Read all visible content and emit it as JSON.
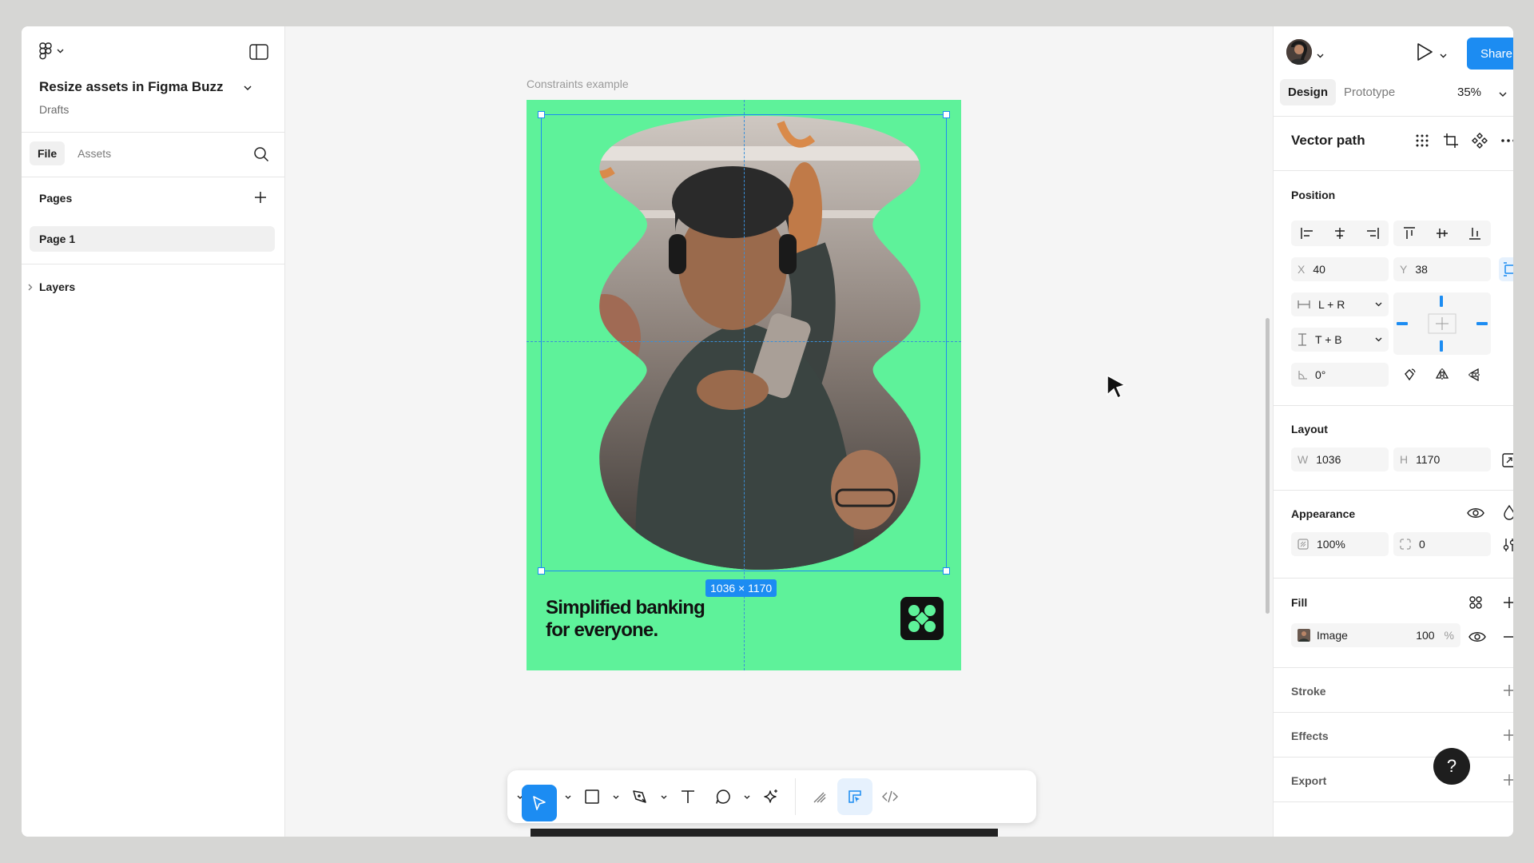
{
  "left_panel": {
    "file_title": "Resize assets in Figma Buzz",
    "location": "Drafts",
    "tabs": [
      "File",
      "Assets"
    ],
    "pages_label": "Pages",
    "pages": [
      "Page 1"
    ],
    "layers_label": "Layers"
  },
  "canvas": {
    "frame_label": "Constraints example",
    "selection_size": "1036 × 1170",
    "tagline_1": "Simplified banking",
    "tagline_2": "for everyone."
  },
  "toolbar": {
    "tools": [
      "move-tool",
      "frame-tool",
      "shape-tool",
      "pen-tool",
      "text-tool",
      "comment-tool",
      "actions-tool",
      "draw-mode",
      "design-mode",
      "dev-mode"
    ],
    "active": "move-tool"
  },
  "right_panel": {
    "share_label": "Share",
    "tabs": [
      "Design",
      "Prototype"
    ],
    "zoom": "35%",
    "selection_name": "Vector path",
    "position": {
      "label": "Position",
      "x_label": "X",
      "x": "40",
      "y_label": "Y",
      "y": "38",
      "h_constraint": "L + R",
      "v_constraint": "T + B",
      "rotation": "0°"
    },
    "layout": {
      "label": "Layout",
      "w_label": "W",
      "w": "1036",
      "h_label": "H",
      "h": "1170"
    },
    "appearance": {
      "label": "Appearance",
      "opacity": "100%",
      "radius": "0"
    },
    "fill": {
      "label": "Fill",
      "type": "Image",
      "opacity": "100",
      "unit": "%"
    },
    "stroke_label": "Stroke",
    "effects_label": "Effects",
    "export_label": "Export",
    "help_label": "?"
  },
  "colors": {
    "accent": "#1c8cf2",
    "frame_bg": "#5ef29a"
  }
}
